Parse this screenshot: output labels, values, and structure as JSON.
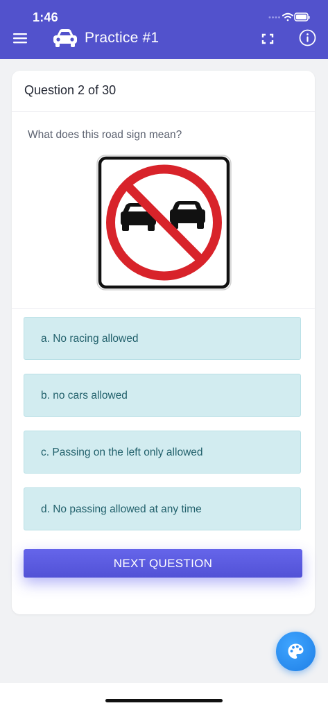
{
  "status_bar": {
    "time": "1:46"
  },
  "app_bar": {
    "title": "Practice #1",
    "icons": [
      "menu-icon",
      "car-icon",
      "fullscreen-icon",
      "info-icon"
    ]
  },
  "quiz": {
    "counter": "Question 2 of 30",
    "question": "What does this road sign mean?",
    "sign": "no-passing-sign",
    "answers": [
      {
        "label": "a. No racing allowed"
      },
      {
        "label": "b. no cars allowed"
      },
      {
        "label": "c. Passing on the left only allowed"
      },
      {
        "label": "d. No passing allowed at any time"
      }
    ],
    "next_label": "NEXT QUESTION"
  },
  "fab": {
    "icon": "palette-icon"
  },
  "colors": {
    "primary": "#5252cc",
    "answer_bg": "#d2ecf0",
    "answer_text": "#21606b",
    "fab": "#2b8ff5",
    "sign_red": "#d8232a"
  }
}
